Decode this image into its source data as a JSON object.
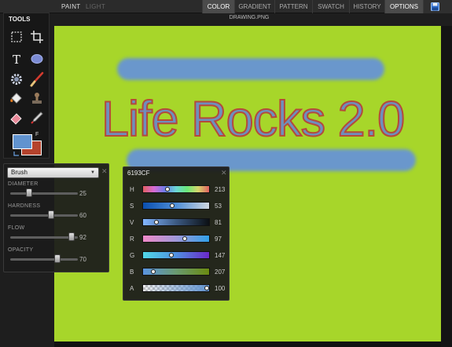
{
  "topbar": {
    "modes": [
      "PAINT",
      "LIGHT"
    ],
    "tabs": [
      "COLOR",
      "GRADIENT",
      "PATTERN",
      "SWATCH",
      "HISTORY",
      "OPTIONS"
    ],
    "save_icon": "floppy-disk-icon"
  },
  "tools": {
    "title": "TOOLS",
    "items": [
      "marquee-select",
      "crop",
      "text",
      "ellipse",
      "gear",
      "brush",
      "fill-bucket",
      "stamp",
      "eraser",
      "eyedropper"
    ],
    "fg_color": "#6193CF",
    "bg_color": "#B5432D",
    "swap_label": "F"
  },
  "document": {
    "title": "DRAWING.PNG",
    "background": "#A7D62A",
    "text": "Life Rocks 2.0"
  },
  "brush_panel": {
    "preset": "Brush",
    "sliders": [
      {
        "label": "DIAMETER",
        "value": "25",
        "fraction": 0.28
      },
      {
        "label": "HARDNESS",
        "value": "60",
        "fraction": 0.6
      },
      {
        "label": "FLOW",
        "value": "92",
        "fraction": 0.92
      },
      {
        "label": "OPACITY",
        "value": "70",
        "fraction": 0.7
      }
    ]
  },
  "color_panel": {
    "hex": "6193CF",
    "channels": [
      {
        "label": "H",
        "value": "213",
        "fraction": 0.59
      },
      {
        "label": "S",
        "value": "53",
        "fraction": 0.53
      },
      {
        "label": "V",
        "value": "81",
        "fraction": 0.19
      },
      {
        "label": "R",
        "value": "97",
        "fraction": 0.62
      },
      {
        "label": "G",
        "value": "147",
        "fraction": 0.41
      },
      {
        "label": "B",
        "value": "207",
        "fraction": 0.13
      },
      {
        "label": "A",
        "value": "100",
        "fraction": 1.0
      }
    ]
  }
}
